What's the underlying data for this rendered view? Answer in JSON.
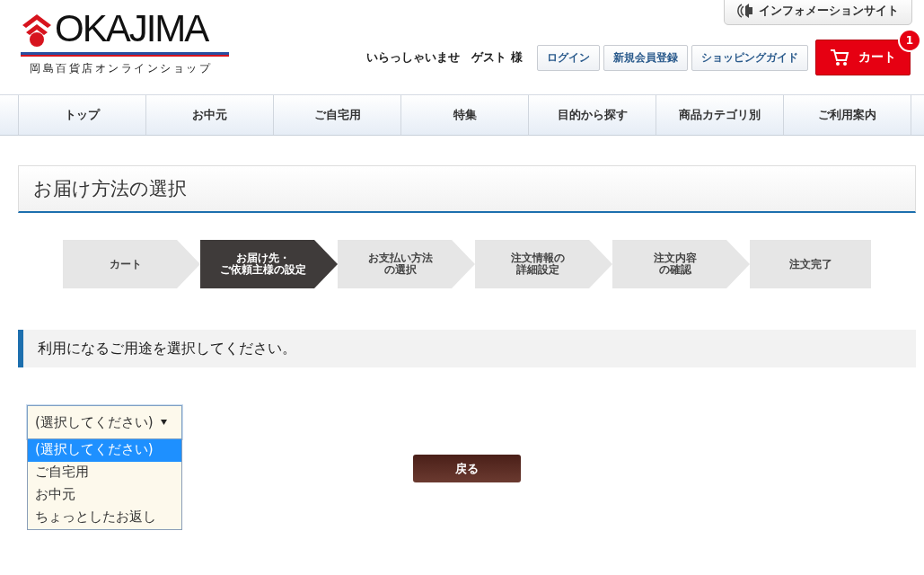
{
  "logo": {
    "wordmark": "OKAJIMA",
    "subtitle": "岡島百貨店オンラインショップ"
  },
  "info_link": "インフォメーションサイト",
  "greeting": "いらっしゃいませ　ゲスト 様",
  "header_buttons": [
    "ログイン",
    "新規会員登録",
    "ショッピングガイド"
  ],
  "cart": {
    "label": "カート",
    "count": "1"
  },
  "nav": [
    "トップ",
    "お中元",
    "ご自宅用",
    "特集",
    "目的から探す",
    "商品カテゴリ別",
    "ご利用案内"
  ],
  "page_title": "お届け方法の選択",
  "steps": [
    {
      "lines": [
        "カート"
      ],
      "selected": false
    },
    {
      "lines": [
        "お届け先・",
        "ご依頼主様の設定"
      ],
      "selected": true
    },
    {
      "lines": [
        "お支払い方法",
        "の選択"
      ],
      "selected": false
    },
    {
      "lines": [
        "注文情報の",
        "詳細設定"
      ],
      "selected": false
    },
    {
      "lines": [
        "注文内容",
        "の確認"
      ],
      "selected": false
    },
    {
      "lines": [
        "注文完了"
      ],
      "selected": false
    }
  ],
  "section_heading": "利用になるご用途を選択してください。",
  "select": {
    "value": "(選択してください)",
    "expanded": true,
    "options": [
      {
        "label": "(選択してください)",
        "selected": true
      },
      {
        "label": "ご自宅用",
        "selected": false
      },
      {
        "label": "お中元",
        "selected": false
      },
      {
        "label": "ちょっとしたお返し",
        "selected": false
      }
    ]
  },
  "back_button": "戻る"
}
